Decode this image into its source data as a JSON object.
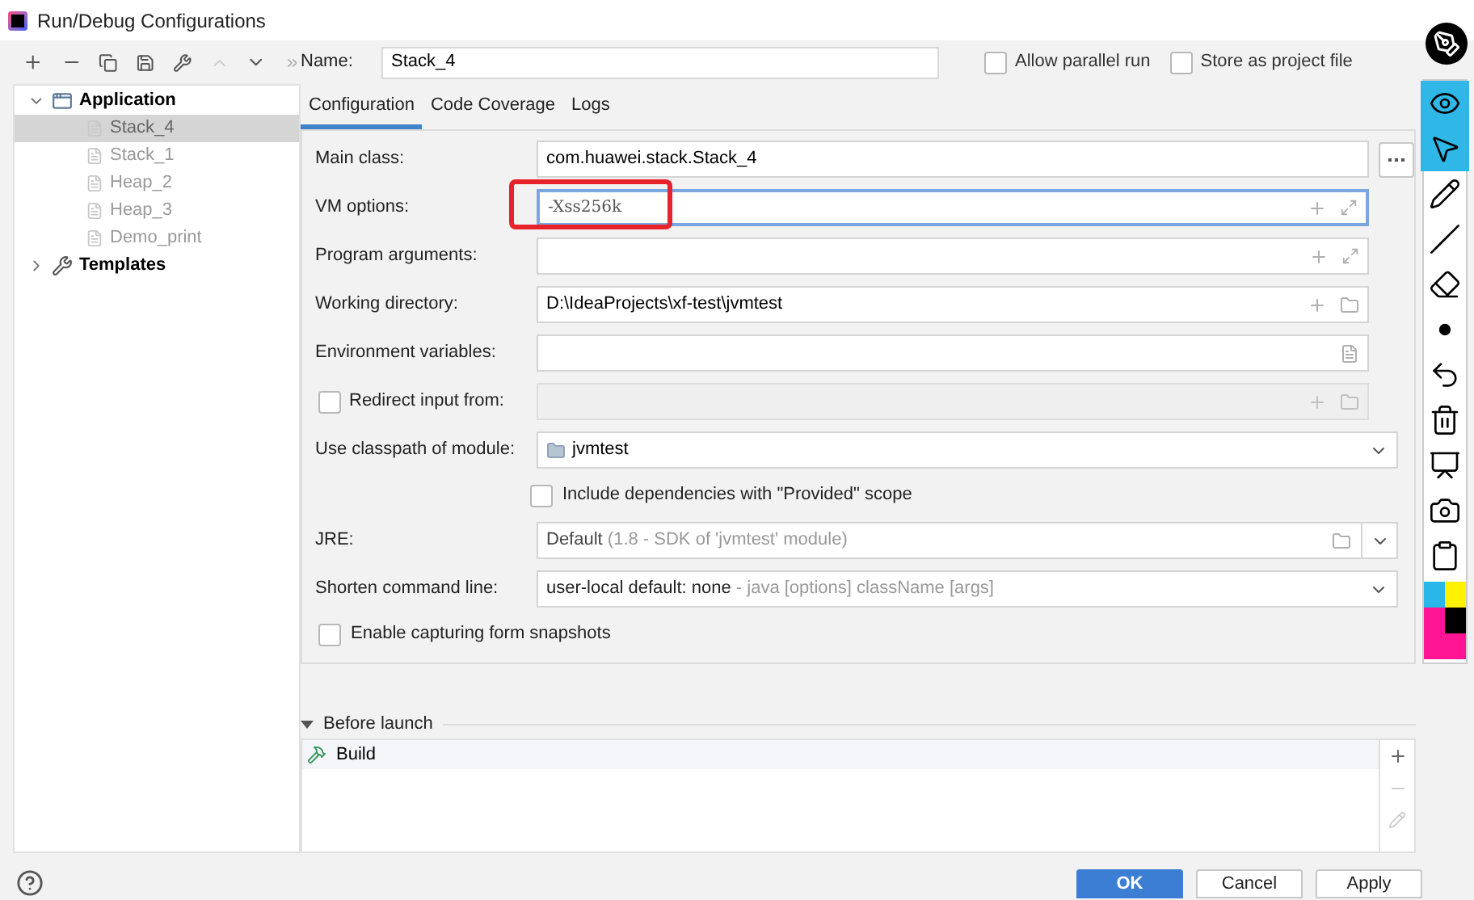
{
  "window": {
    "title": "Run/Debug Configurations"
  },
  "tree": [
    {
      "label": "Application",
      "expanded": true,
      "children": [
        {
          "label": "Stack_4",
          "selected": true
        },
        {
          "label": "Stack_1",
          "selected": false
        },
        {
          "label": "Heap_2",
          "selected": false
        },
        {
          "label": "Heap_3",
          "selected": false
        },
        {
          "label": "Demo_print",
          "selected": false
        }
      ]
    },
    {
      "label": "Templates",
      "expanded": false
    }
  ],
  "name": {
    "label": "Name:",
    "value": "Stack_4"
  },
  "options": [
    {
      "label": "Allow parallel run",
      "checked": false
    },
    {
      "label": "Store as project file",
      "checked": false
    }
  ],
  "tabs": [
    {
      "label": "Configuration",
      "selected": true
    },
    {
      "label": "Code Coverage",
      "selected": false
    },
    {
      "label": "Logs",
      "selected": false
    }
  ],
  "fields": [
    {
      "kind": "browse",
      "label": "Main class:",
      "value": "com.huawei.stack.Stack_4"
    },
    {
      "kind": "expand",
      "label": "VM options:",
      "value": "-Xss256k",
      "focused": true,
      "annotated": true
    },
    {
      "kind": "expand",
      "label": "Program arguments:",
      "focused": false,
      "annotated": false
    },
    {
      "kind": "folder",
      "label": "Working directory:",
      "value": "D:\\IdeaProjects\\xf-test\\jvmtest"
    },
    {
      "kind": "env",
      "label": "Environment variables:"
    },
    {
      "kind": "redirect",
      "label": "Redirect input from:",
      "checked": false
    },
    {
      "kind": "module",
      "label": "Use classpath of module:",
      "value": "jvmtest"
    },
    {
      "kind": "checkbox",
      "label": "Include dependencies with \"Provided\" scope",
      "checked": false,
      "indent": true
    },
    {
      "kind": "jre",
      "label": "JRE:",
      "value": "Default",
      "hint": "(1.8 - SDK of 'jvmtest' module)"
    },
    {
      "kind": "shorten",
      "label": "Shorten command line:",
      "value": "user-local default: none",
      "hint": "- java [options] className [args]"
    },
    {
      "kind": "checkbox",
      "label": "Enable capturing form snapshots",
      "checked": false,
      "indent": false
    }
  ],
  "before_launch": {
    "label": "Before launch",
    "expanded": true,
    "tasks": [
      {
        "label": "Build"
      }
    ]
  },
  "annotation_tools": [
    {
      "kind": "eye",
      "selected": true
    },
    {
      "kind": "pointer",
      "selected": true
    },
    {
      "kind": "pen",
      "selected": false
    },
    {
      "kind": "line",
      "selected": false
    },
    {
      "kind": "eraser",
      "selected": false
    },
    {
      "kind": "dot",
      "selected": false
    },
    {
      "kind": "undo",
      "selected": false
    },
    {
      "kind": "trash",
      "selected": false
    },
    {
      "kind": "board",
      "selected": false
    },
    {
      "kind": "camera",
      "selected": false
    },
    {
      "kind": "clipboard",
      "selected": false
    },
    {
      "kind": "colors",
      "selected": false
    }
  ],
  "buttons": [
    {
      "label": "OK",
      "primary": true
    },
    {
      "label": "Cancel",
      "primary": false
    },
    {
      "label": "Apply",
      "primary": false
    }
  ]
}
